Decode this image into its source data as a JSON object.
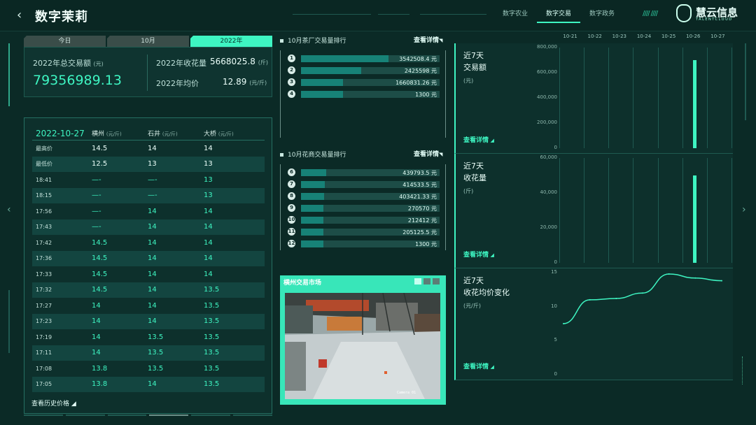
{
  "header": {
    "title": "数字茉莉",
    "nav_tabs": [
      "数字农业",
      "数字交易",
      "数字政务"
    ],
    "active_tab": 1,
    "logo_name": "慧云信息",
    "logo_sub": "TALENTCLOUD"
  },
  "period_tabs": [
    "今日",
    "10月",
    "2022年"
  ],
  "active_period": 2,
  "summary": {
    "total_label": "2022年总交易额",
    "total_unit": "(元)",
    "total_value": "79356989.13",
    "harvest_label": "2022年收花量",
    "harvest_value": "5668025.8",
    "harvest_unit": "(斤)",
    "avg_label": "2022年均价",
    "avg_value": "12.89",
    "avg_unit": "(元/斤)"
  },
  "price_table": {
    "date": "2022-10-27",
    "columns": [
      {
        "name": "横州",
        "unit": "(元/斤)"
      },
      {
        "name": "石井",
        "unit": "(元/斤)"
      },
      {
        "name": "大桥",
        "unit": "(元/斤)"
      }
    ],
    "rows": [
      {
        "label": "最高价",
        "v": [
          "14.5",
          "14",
          "14"
        ],
        "c": [
          "w",
          "w",
          "w"
        ]
      },
      {
        "label": "最低价",
        "v": [
          "12.5",
          "13",
          "13"
        ],
        "c": [
          "w",
          "w",
          "w"
        ]
      },
      {
        "label": "18:41",
        "v": [
          "—-",
          "—-",
          "13"
        ],
        "c": [
          "g",
          "g",
          "g"
        ]
      },
      {
        "label": "18:15",
        "v": [
          "—-",
          "—-",
          "13"
        ],
        "c": [
          "g",
          "g",
          "g"
        ]
      },
      {
        "label": "17:56",
        "v": [
          "—-",
          "14",
          "14"
        ],
        "c": [
          "g",
          "g",
          "g"
        ]
      },
      {
        "label": "17:43",
        "v": [
          "—-",
          "14",
          "14"
        ],
        "c": [
          "g",
          "g",
          "g"
        ]
      },
      {
        "label": "17:42",
        "v": [
          "14.5",
          "14",
          "14"
        ],
        "c": [
          "g",
          "g",
          "g"
        ]
      },
      {
        "label": "17:36",
        "v": [
          "14.5",
          "14",
          "14"
        ],
        "c": [
          "g",
          "g",
          "g"
        ]
      },
      {
        "label": "17:33",
        "v": [
          "14.5",
          "14",
          "14"
        ],
        "c": [
          "g",
          "g",
          "g"
        ]
      },
      {
        "label": "17:32",
        "v": [
          "14.5",
          "14",
          "13.5"
        ],
        "c": [
          "g",
          "g",
          "g"
        ]
      },
      {
        "label": "17:27",
        "v": [
          "14",
          "14",
          "13.5"
        ],
        "c": [
          "g",
          "g",
          "g"
        ]
      },
      {
        "label": "17:23",
        "v": [
          "14",
          "14",
          "13.5"
        ],
        "c": [
          "g",
          "g",
          "g"
        ]
      },
      {
        "label": "17:19",
        "v": [
          "14",
          "13.5",
          "13.5"
        ],
        "c": [
          "g",
          "g",
          "g"
        ]
      },
      {
        "label": "17:11",
        "v": [
          "14",
          "13.5",
          "13.5"
        ],
        "c": [
          "g",
          "g",
          "g"
        ]
      },
      {
        "label": "17:08",
        "v": [
          "13.8",
          "13.5",
          "13.5"
        ],
        "c": [
          "g",
          "g",
          "g"
        ]
      },
      {
        "label": "17:05",
        "v": [
          "13.8",
          "14",
          "13.5"
        ],
        "c": [
          "g",
          "g",
          "g"
        ]
      }
    ],
    "history_link": "查看历史价格"
  },
  "tea_ranking": {
    "title": "10月茶厂交易量排行",
    "detail": "查看详情",
    "items": [
      {
        "rank": "1",
        "value": 3542508.4,
        "label": "3542508.4 元"
      },
      {
        "rank": "2",
        "value": 2425598,
        "label": "2425598 元"
      },
      {
        "rank": "3",
        "value": 1660831.26,
        "label": "1660831.26 元"
      },
      {
        "rank": "4",
        "value": 1300,
        "label": "1300 元"
      }
    ]
  },
  "flower_ranking": {
    "title": "10月花商交易量排行",
    "detail": "查看详情",
    "items": [
      {
        "rank": "6",
        "value": 439793.5,
        "label": "439793.5 元"
      },
      {
        "rank": "7",
        "value": 414533.5,
        "label": "414533.5 元"
      },
      {
        "rank": "8",
        "value": 403421.33,
        "label": "403421.33 元"
      },
      {
        "rank": "9",
        "value": 270570,
        "label": "270570 元"
      },
      {
        "rank": "10",
        "value": 212412,
        "label": "212412 元"
      },
      {
        "rank": "11",
        "value": 205125.5,
        "label": "205125.5 元"
      },
      {
        "rank": "12",
        "value": 1300,
        "label": "1300 元"
      }
    ]
  },
  "video": {
    "title": "横州交易市场",
    "camera_label": "Camera 01"
  },
  "chart_data": [
    {
      "type": "bar",
      "title": "近7天 交易额",
      "title_line1": "近7天",
      "title_line2": "交易额",
      "ylabel": "(元)",
      "categories": [
        "10-21",
        "10-22",
        "10-23",
        "10-24",
        "10-25",
        "10-26",
        "10-27"
      ],
      "values": [
        0,
        0,
        0,
        0,
        0,
        700000,
        0
      ],
      "ylim": [
        0,
        800000
      ],
      "yticks": [
        "800,000",
        "600,000",
        "400,000",
        "200,000",
        "0"
      ],
      "ytick_values": [
        800000,
        600000,
        400000,
        200000,
        0
      ],
      "grid": true,
      "detail": "查看详情"
    },
    {
      "type": "bar",
      "title": "近7天 收花量",
      "title_line1": "近7天",
      "title_line2": "收花量",
      "ylabel": "(斤)",
      "categories": [
        "10-21",
        "10-22",
        "10-23",
        "10-24",
        "10-25",
        "10-26",
        "10-27"
      ],
      "values": [
        0,
        0,
        0,
        0,
        0,
        50000,
        0
      ],
      "ylim": [
        0,
        60000
      ],
      "yticks": [
        "60,000",
        "40,000",
        "20,000",
        "0"
      ],
      "ytick_values": [
        60000,
        40000,
        20000,
        0
      ],
      "grid": true,
      "detail": "查看详情"
    },
    {
      "type": "line",
      "title": "近7天 收花均价变化",
      "title_line1": "近7天",
      "title_line2": "收花均价变化",
      "ylabel": "(元/斤)",
      "categories": [
        "10-21",
        "10-22",
        "10-23",
        "10-24",
        "10-25",
        "10-26",
        "10-27"
      ],
      "values": [
        7.5,
        11,
        11.2,
        12,
        14.8,
        14.2,
        13.8
      ],
      "ylim": [
        0,
        15
      ],
      "yticks": [
        "15",
        "10",
        "5",
        "0"
      ],
      "ytick_values": [
        15,
        10,
        5,
        0
      ],
      "grid": false,
      "detail": "查看详情"
    }
  ],
  "colors": {
    "accent": "#3ef5c2",
    "background": "#0b2a26",
    "panel": "#0d302c",
    "bar_rank": "#178277"
  }
}
